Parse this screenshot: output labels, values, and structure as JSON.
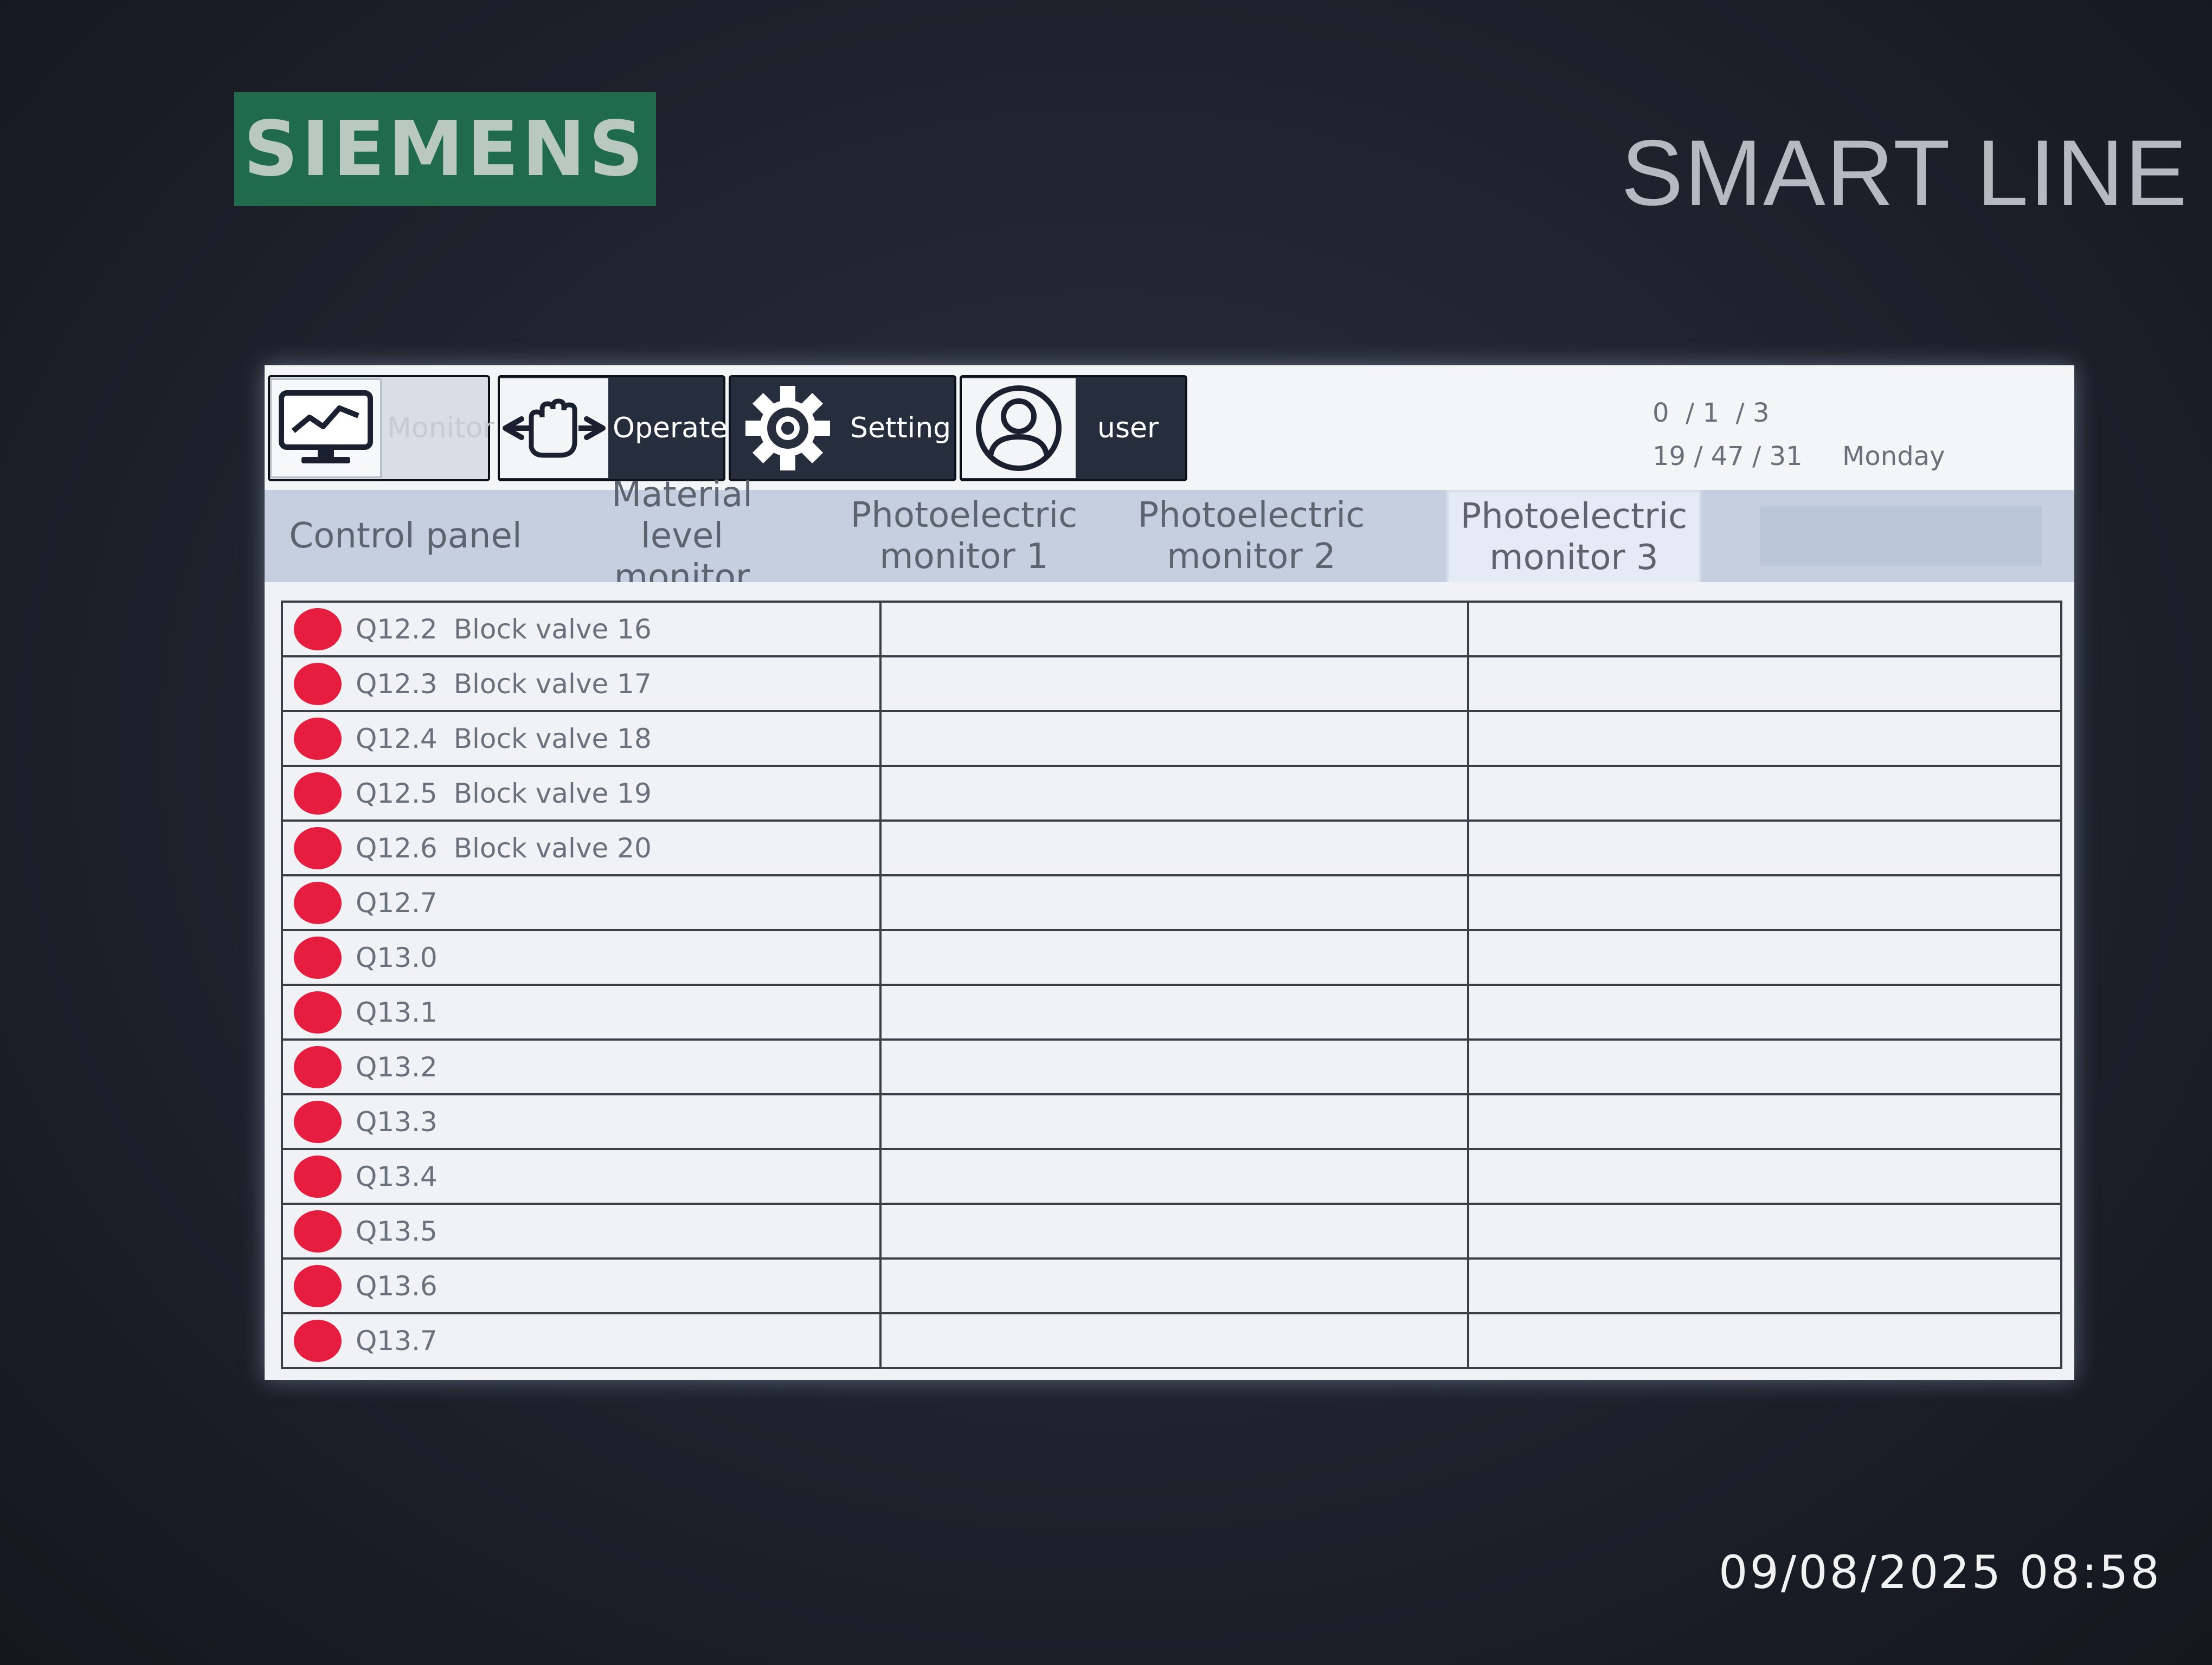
{
  "device": {
    "brand": "SIEMENS",
    "product_line": "SMART LINE",
    "photo_timestamp": "09/08/2025 08:58"
  },
  "nav": {
    "monitor_label": "Monitor",
    "operate_label": "Operate",
    "setting_label": "Setting",
    "user_label": "user"
  },
  "clock": {
    "date": "0  / 1  / 3",
    "time": "19 / 47 / 31",
    "weekday": "Monday"
  },
  "tabs": [
    {
      "label": "Control panel",
      "active": false
    },
    {
      "label": "Material level monitor",
      "active": false
    },
    {
      "label": "Photoelectric monitor 1",
      "active": false
    },
    {
      "label": "Photoelectric monitor 2",
      "active": false
    },
    {
      "label": "Photoelectric monitor 3",
      "active": true
    }
  ],
  "lamp_color": "#e61d3f",
  "rows": [
    {
      "address": "Q12.2",
      "description": "Block valve 16"
    },
    {
      "address": "Q12.3",
      "description": "Block valve 17"
    },
    {
      "address": "Q12.4",
      "description": "Block valve 18"
    },
    {
      "address": "Q12.5",
      "description": "Block valve 19"
    },
    {
      "address": "Q12.6",
      "description": "Block valve 20"
    },
    {
      "address": "Q12.7",
      "description": ""
    },
    {
      "address": "Q13.0",
      "description": ""
    },
    {
      "address": "Q13.1",
      "description": ""
    },
    {
      "address": "Q13.2",
      "description": ""
    },
    {
      "address": "Q13.3",
      "description": ""
    },
    {
      "address": "Q13.4",
      "description": ""
    },
    {
      "address": "Q13.5",
      "description": ""
    },
    {
      "address": "Q13.6",
      "description": ""
    },
    {
      "address": "Q13.7",
      "description": ""
    }
  ]
}
